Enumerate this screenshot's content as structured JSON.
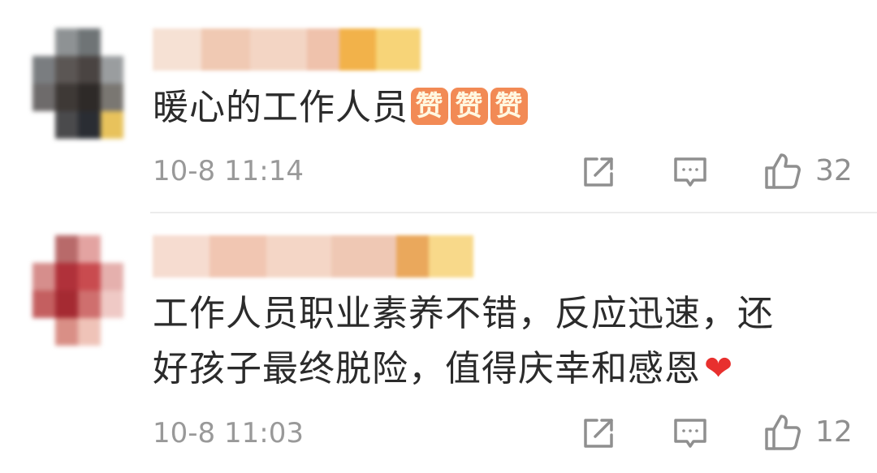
{
  "comments": [
    {
      "text": "暖心的工作人员",
      "emoji": [
        "赞",
        "赞",
        "赞"
      ],
      "time": "10-8 11:14",
      "likes": "32"
    },
    {
      "text_line1": "工作人员职业素养不错，反应迅速，还",
      "text_line2": "好孩子最终脱险，值得庆幸和感恩",
      "emoji": "❤",
      "time": "10-8 11:03",
      "likes": "12"
    }
  ],
  "icons": [
    "share-icon",
    "comment-icon",
    "like-icon"
  ],
  "colors": {
    "text": "#2b2b2b",
    "meta": "#999999",
    "emoji_badge": "#f28a55",
    "heart": "#e8302e",
    "divider": "#ececec"
  }
}
